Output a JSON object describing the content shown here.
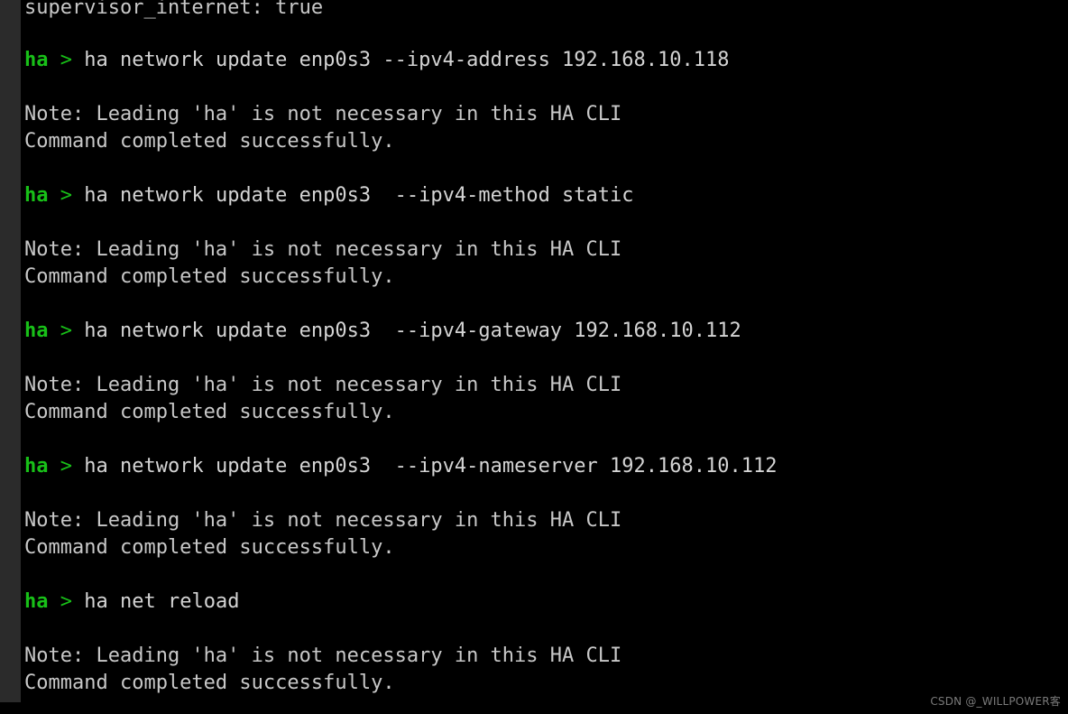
{
  "terminal": {
    "background_color": "#000000",
    "gutter_color": "#2b2b2b",
    "text_color": "#cccccc",
    "prompt_color": "#18c018",
    "prompt_user": "ha",
    "prompt_symbol": ">"
  },
  "lines": [
    {
      "type": "output",
      "text": "supervisor_internet: true"
    },
    {
      "type": "blank",
      "text": " "
    },
    {
      "type": "command",
      "text": "ha network update enp0s3 --ipv4-address 192.168.10.118"
    },
    {
      "type": "blank",
      "text": " "
    },
    {
      "type": "output",
      "text": "Note: Leading 'ha' is not necessary in this HA CLI"
    },
    {
      "type": "output",
      "text": "Command completed successfully."
    },
    {
      "type": "blank",
      "text": " "
    },
    {
      "type": "command",
      "text": "ha network update enp0s3  --ipv4-method static"
    },
    {
      "type": "blank",
      "text": " "
    },
    {
      "type": "output",
      "text": "Note: Leading 'ha' is not necessary in this HA CLI"
    },
    {
      "type": "output",
      "text": "Command completed successfully."
    },
    {
      "type": "blank",
      "text": " "
    },
    {
      "type": "command",
      "text": "ha network update enp0s3  --ipv4-gateway 192.168.10.112"
    },
    {
      "type": "blank",
      "text": " "
    },
    {
      "type": "output",
      "text": "Note: Leading 'ha' is not necessary in this HA CLI"
    },
    {
      "type": "output",
      "text": "Command completed successfully."
    },
    {
      "type": "blank",
      "text": " "
    },
    {
      "type": "command",
      "text": "ha network update enp0s3  --ipv4-nameserver 192.168.10.112"
    },
    {
      "type": "blank",
      "text": " "
    },
    {
      "type": "output",
      "text": "Note: Leading 'ha' is not necessary in this HA CLI"
    },
    {
      "type": "output",
      "text": "Command completed successfully."
    },
    {
      "type": "blank",
      "text": " "
    },
    {
      "type": "command",
      "text": "ha net reload"
    },
    {
      "type": "blank",
      "text": " "
    },
    {
      "type": "output",
      "text": "Note: Leading 'ha' is not necessary in this HA CLI"
    },
    {
      "type": "output",
      "text": "Command completed successfully."
    }
  ],
  "watermark": {
    "text": "CSDN @_WILLPOWER客"
  }
}
